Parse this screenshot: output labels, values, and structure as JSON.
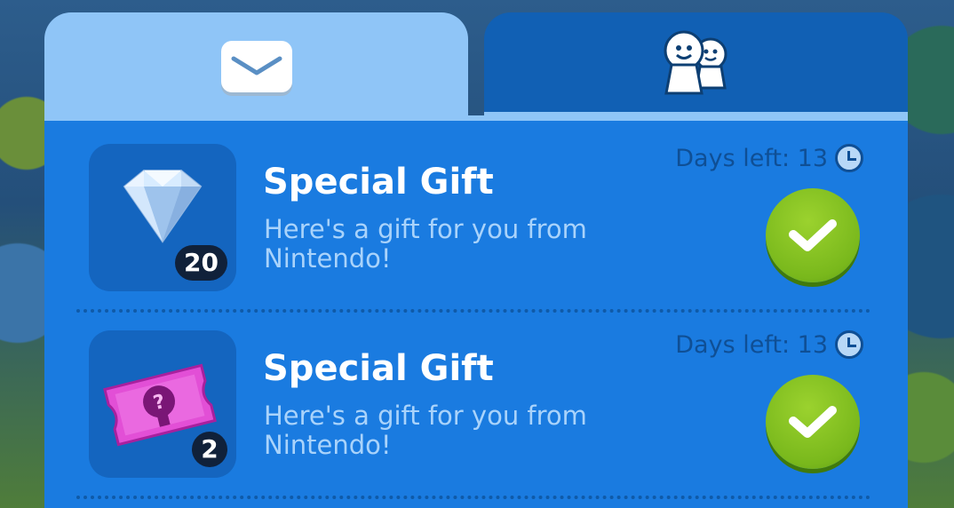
{
  "tabs": [
    {
      "name": "mail",
      "icon": "envelope-icon",
      "active": true
    },
    {
      "name": "friends",
      "icon": "friends-icon",
      "active": false
    }
  ],
  "gifts": [
    {
      "title": "Special Gift",
      "message": "Here's a gift for you from Nintendo!",
      "days_left": "Days left: 13",
      "quantity": "20",
      "item_icon": "diamond-icon",
      "accept_icon": "checkmark-icon"
    },
    {
      "title": "Special Gift",
      "message": "Here's a gift for you from Nintendo!",
      "days_left": "Days left: 13",
      "quantity": "2",
      "item_icon": "ticket-icon",
      "accept_icon": "checkmark-icon"
    }
  ],
  "colors": {
    "panel": "#1a7be0",
    "active_tab": "#8fc5f7",
    "inactive_tab": "#1160b4",
    "accept": "#79b81c"
  }
}
